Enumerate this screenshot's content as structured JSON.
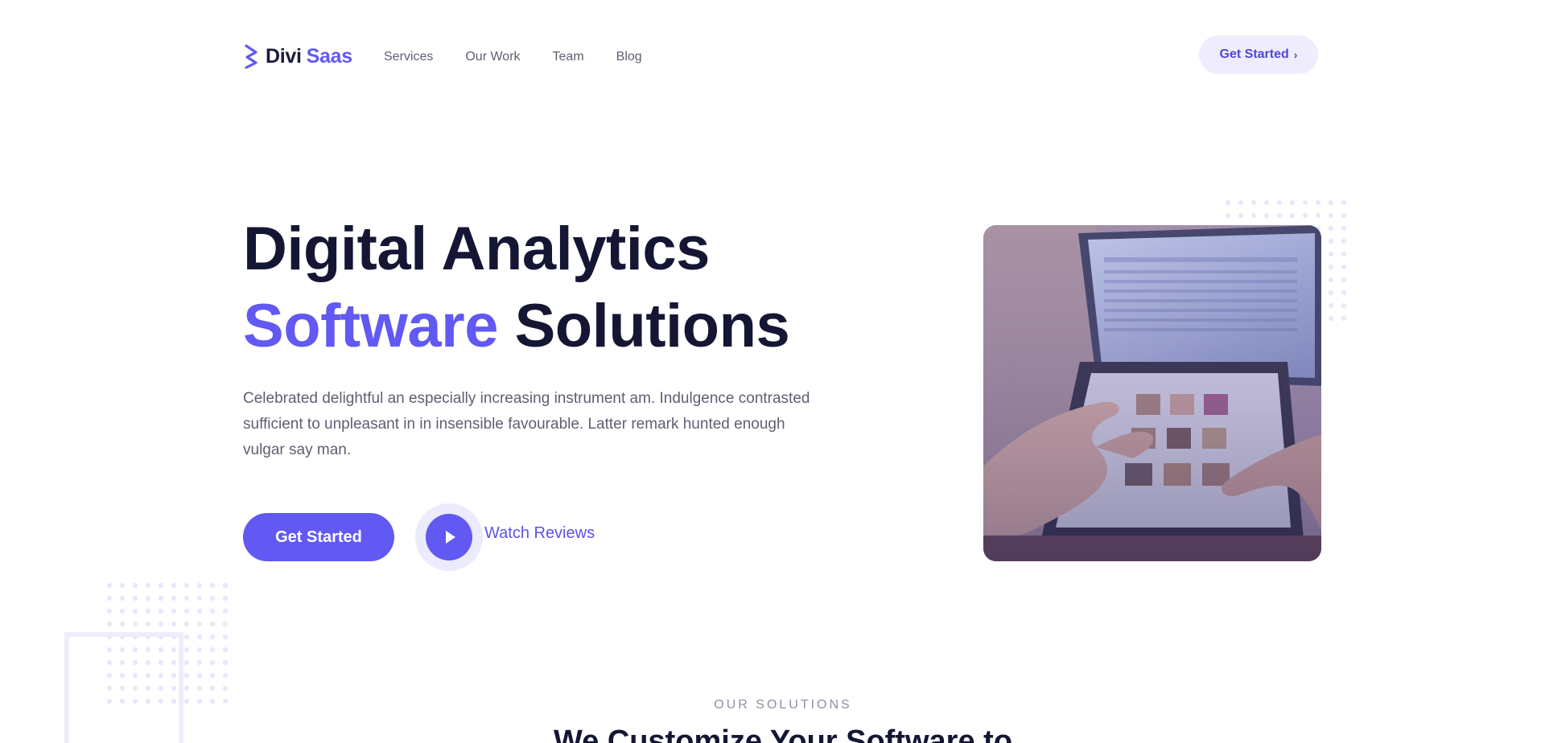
{
  "brand": {
    "name": "Divi",
    "accent": "Saas",
    "icon": "logo-mark-icon",
    "colors": {
      "primary": "#6159f1",
      "dark": "#141634",
      "muted": "#5e5f72",
      "tint": "#efedfd"
    }
  },
  "nav": {
    "items": [
      {
        "label": "Services"
      },
      {
        "label": "Our Work"
      },
      {
        "label": "Team"
      },
      {
        "label": "Blog"
      }
    ],
    "cta": "Get Started",
    "cta_icon": "chevron-right-icon"
  },
  "hero": {
    "title_line1": "Digital Analytics",
    "title_accent": "Software",
    "title_rest": "Solutions",
    "body": "Celebrated delightful an especially increasing instrument am. Indulgence contrasted sufficient to unpleasant in in insensible favourable. Latter remark hunted enough vulgar say man.",
    "primary_cta": "Get Started",
    "video_cta": "Watch Reviews",
    "video_icon": "play-icon"
  },
  "solutions": {
    "eyebrow": "OUR SOLUTIONS",
    "title": "We Customize Your Software to"
  }
}
